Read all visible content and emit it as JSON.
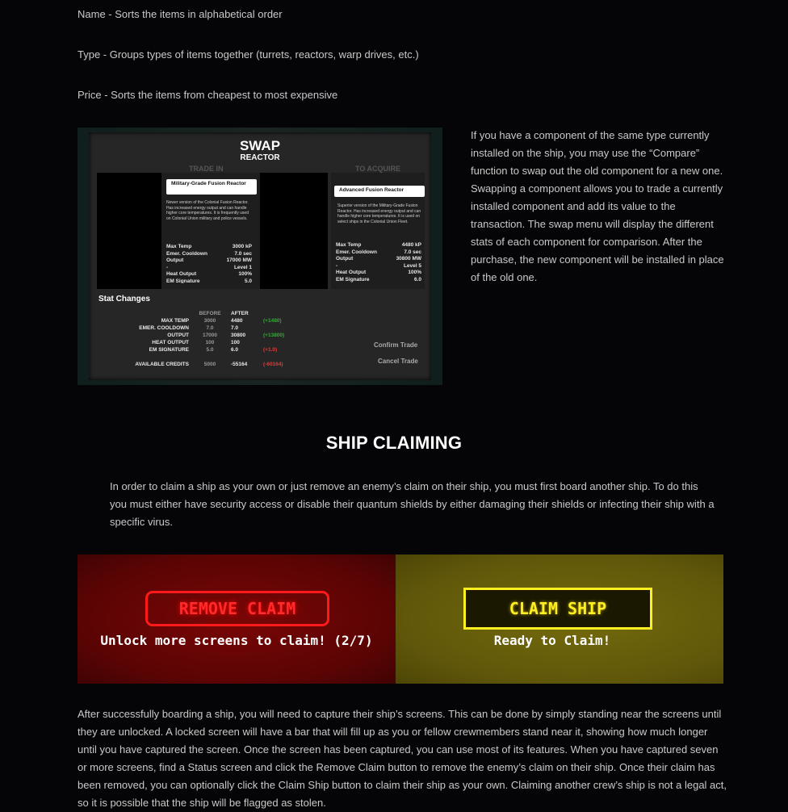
{
  "sort_options": [
    "Name - Sorts the items in alphabetical order",
    "Type - Groups types of items together (turrets, reactors, warp drives, etc.)",
    "Price - Sorts the items from cheapest to most expensive"
  ],
  "swap": {
    "title": "SWAP",
    "subtitle": "REACTOR",
    "trade_in_label": "TRADE IN",
    "to_acquire_label": "TO ACQUIRE",
    "left": {
      "name": "Military-Grade Fusion Reactor",
      "desc": "Newer version of the Colonial Fusion Reactor. Has increased energy output and can handle higher core temperatures. It is frequently used on Colonial Union military and police vessels.",
      "stats": [
        {
          "label": "Max Temp",
          "value": "3000 kP"
        },
        {
          "label": "Emer. Cooldown",
          "value": "7.0 sec"
        },
        {
          "label": "Output",
          "value": "17000 MW"
        },
        {
          "label": "-",
          "value": "Level 1"
        },
        {
          "label": "Heat Output",
          "value": "100%"
        },
        {
          "label": "EM Signature",
          "value": "5.0"
        }
      ]
    },
    "right": {
      "name": "Advanced Fusion Reactor",
      "desc": "Superior version of the Military-Grade Fusion Reactor. Has increased energy output and can handle higher core temperatures. It is used on select ships in the Colonial Union Fleet.",
      "stats": [
        {
          "label": "Max Temp",
          "value": "4480 kP"
        },
        {
          "label": "Emer. Cooldown",
          "value": "7.0 sec"
        },
        {
          "label": "Output",
          "value": "30800 MW"
        },
        {
          "label": "-",
          "value": "Level 5"
        },
        {
          "label": "Heat Output",
          "value": "100%"
        },
        {
          "label": "EM Signature",
          "value": "6.0"
        }
      ]
    },
    "stat_changes_label": "Stat Changes",
    "col_before": "BEFORE",
    "col_after": "AFTER",
    "rows": [
      {
        "label": "MAX TEMP",
        "before": "3000",
        "after": "4480",
        "delta": "(+1480)",
        "tone": "green"
      },
      {
        "label": "EMER. COOLDOWN",
        "before": "7.0",
        "after": "7.0",
        "delta": "",
        "tone": ""
      },
      {
        "label": "OUTPUT",
        "before": "17000",
        "after": "30800",
        "delta": "(+13800)",
        "tone": "green"
      },
      {
        "label": "HEAT OUTPUT",
        "before": "100",
        "after": "100",
        "delta": "",
        "tone": ""
      },
      {
        "label": "EM SIGNATURE",
        "before": "5.0",
        "after": "6.0",
        "delta": "(+1.0)",
        "tone": "red"
      }
    ],
    "credits": {
      "label": "AVAILABLE CREDITS",
      "before": "5000",
      "after": "-55164",
      "delta": "(-60164)"
    },
    "confirm_label": "Confirm Trade",
    "cancel_label": "Cancel Trade"
  },
  "compare_paragraph": "If you have a component of the same type currently installed on the ship, you may use the “Compare” function to swap out the old component for a new one. Swapping a component allows you to trade a currently installed component and add its value to the transaction. The swap menu will display the different stats of each component for comparison. After the purchase, the new component will be installed in place of the old one.",
  "claiming": {
    "heading": "SHIP CLAIMING",
    "intro": "In order to claim a ship as your own or just remove an enemy’s claim on their ship, you must first board another ship. To do this you must either have security access or disable their quantum shields by either damaging their shields or infecting their ship with a specific virus.",
    "remove_label": "REMOVE CLAIM",
    "remove_status": "Unlock more screens to claim! (2/7)",
    "claim_label": "CLAIM SHIP",
    "claim_status": "Ready to Claim!",
    "body": "After successfully boarding a ship, you will need to capture their ship’s screens. This can be done by simply standing near the screens until they are unlocked. A locked screen will have a bar that will fill up as you or fellow crewmembers stand near it, showing how much longer until you have captured the screen. Once the screen has been captured, you can use most of its features. When you have captured seven or more screens, find a Status screen and click the Remove Claim button to remove the enemy’s claim on their ship. Once their claim has been removed, you can optionally click the Claim Ship button to claim their ship as your own. Claiming another crew’s ship is not a legal act, so it is possible that the ship will be flagged as stolen."
  },
  "colors": {
    "remove_red": "#ff1a1a",
    "claim_yellow": "#ffee22"
  }
}
